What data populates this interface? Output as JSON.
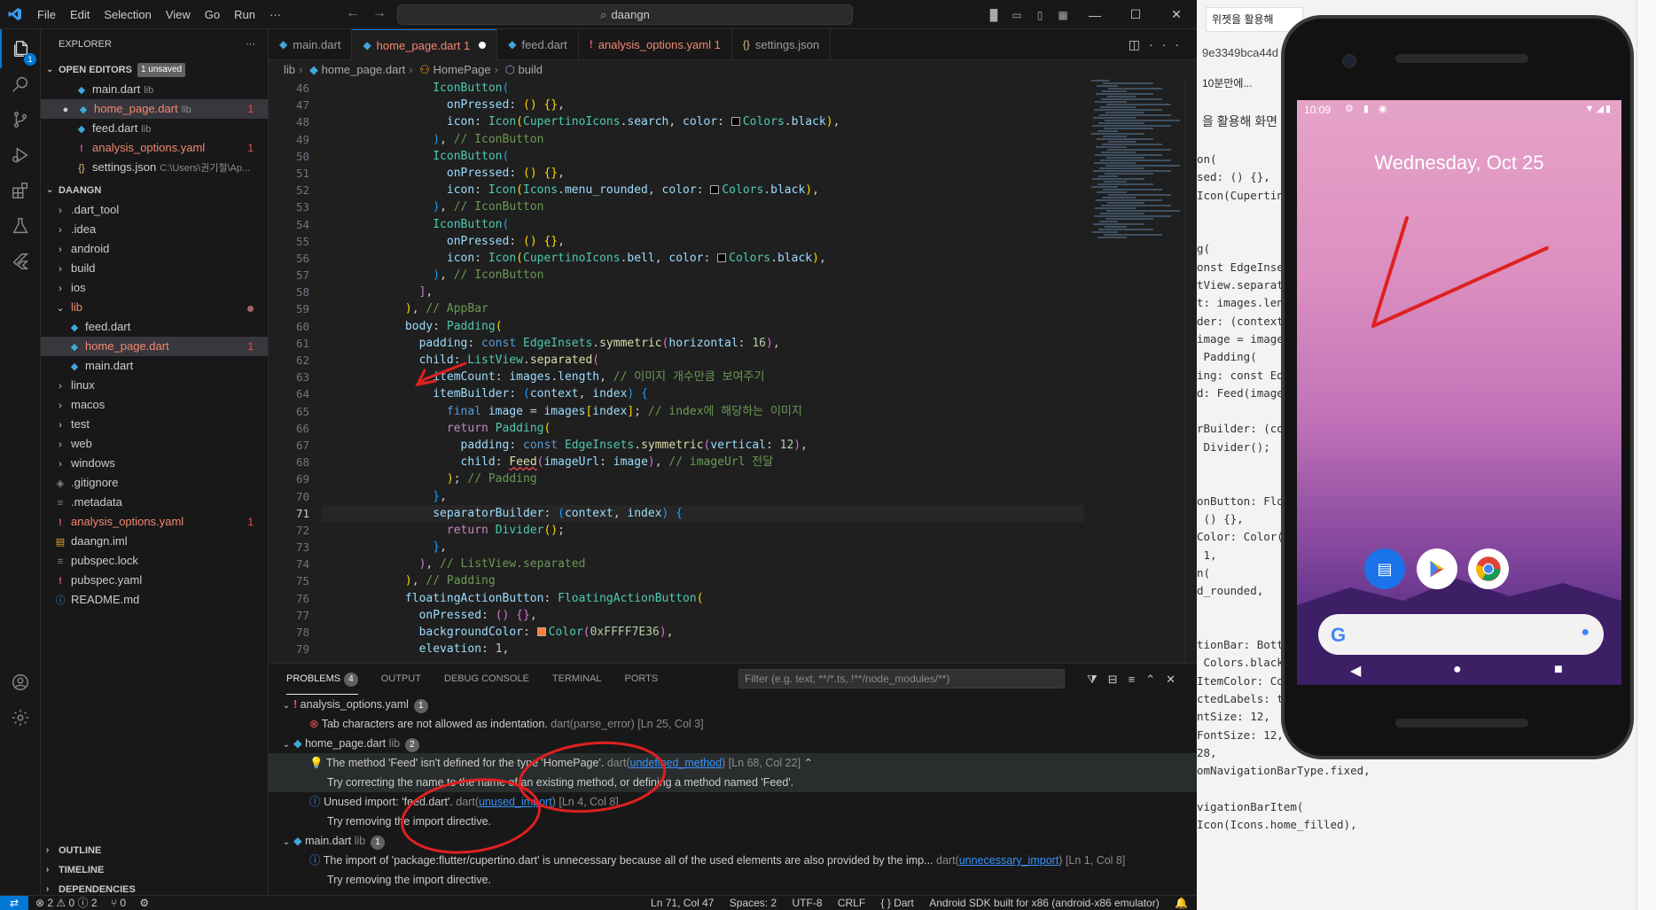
{
  "titlebar": {
    "logo": "VS",
    "menus": [
      "File",
      "Edit",
      "Selection",
      "View",
      "Go",
      "Run",
      "···"
    ],
    "search": "daangn",
    "window_controls": [
      "minimize",
      "maximize",
      "close"
    ]
  },
  "activity": {
    "explorer_badge": "1"
  },
  "sidebar": {
    "title": "EXPLORER",
    "more": "···",
    "open_editors": {
      "title": "OPEN EDITORS",
      "badge": "1 unsaved",
      "items": [
        {
          "name": "main.dart",
          "desc": "lib",
          "count": ""
        },
        {
          "name": "home_page.dart",
          "desc": "lib",
          "count": "1"
        },
        {
          "name": "feed.dart",
          "desc": "lib",
          "count": ""
        },
        {
          "name": "analysis_options.yaml",
          "desc": "",
          "count": "1"
        },
        {
          "name": "settings.json",
          "desc": "C:\\Users\\권기철\\Ap...",
          "count": ""
        }
      ]
    },
    "project": {
      "title": "DAANGN",
      "items": [
        {
          "name": ".dart_tool"
        },
        {
          "name": ".idea"
        },
        {
          "name": "android"
        },
        {
          "name": "build"
        },
        {
          "name": "ios"
        },
        {
          "name": "lib"
        },
        {
          "name": "feed.dart"
        },
        {
          "name": "home_page.dart",
          "count": "1"
        },
        {
          "name": "main.dart"
        },
        {
          "name": "linux"
        },
        {
          "name": "macos"
        },
        {
          "name": "test"
        },
        {
          "name": "web"
        },
        {
          "name": "windows"
        },
        {
          "name": ".gitignore"
        },
        {
          "name": ".metadata"
        },
        {
          "name": "analysis_options.yaml",
          "count": "1"
        },
        {
          "name": "daangn.iml"
        },
        {
          "name": "pubspec.lock"
        },
        {
          "name": "pubspec.yaml"
        },
        {
          "name": "README.md"
        }
      ]
    },
    "bottom_sections": [
      "OUTLINE",
      "TIMELINE",
      "DEPENDENCIES"
    ]
  },
  "tabs": [
    {
      "name": "main.dart",
      "extra": ""
    },
    {
      "name": "home_page.dart",
      "extra": "1"
    },
    {
      "name": "feed.dart",
      "extra": ""
    },
    {
      "name": "analysis_options.yaml",
      "extra": "1"
    },
    {
      "name": "settings.json",
      "extra": ""
    }
  ],
  "breadcrumb": [
    "lib",
    "home_page.dart",
    "HomePage",
    "build"
  ],
  "editor": {
    "line_numbers": [
      "46",
      "47",
      "48",
      "49",
      "50",
      "51",
      "52",
      "53",
      "54",
      "55",
      "56",
      "57",
      "58",
      "59",
      "60",
      "61",
      "62",
      "63",
      "64",
      "65",
      "66",
      "67",
      "68",
      "69",
      "70",
      "71",
      "72",
      "73",
      "74",
      "75",
      "76",
      "77",
      "78",
      "79"
    ],
    "current_line": "71"
  },
  "panel": {
    "tabs": [
      "PROBLEMS",
      "OUTPUT",
      "DEBUG CONSOLE",
      "TERMINAL",
      "PORTS"
    ],
    "problems_count": "4",
    "filter_placeholder": "Filter (e.g. text, **/*.ts, !**/node_modules/**)",
    "groups": [
      {
        "file": "analysis_options.yaml",
        "desc": "",
        "count": "1"
      },
      {
        "file": "home_page.dart",
        "desc": "lib",
        "count": "2"
      },
      {
        "file": "main.dart",
        "desc": "lib",
        "count": "1"
      }
    ],
    "problems": [
      {
        "msg": "Tab characters are not allowed as indentation.",
        "src": "dart(parse_error)",
        "code": "",
        "loc": "[Ln 25, Col 3]"
      },
      {
        "msg": "The method 'Feed' isn't defined for the type 'HomePage'.",
        "src": "dart(",
        "code": "undefined_method",
        "loc": "[Ln 68, Col 22]"
      },
      {
        "msg": "Try correcting the name to the name of an existing method, or defining a method named 'Feed'."
      },
      {
        "msg": "Unused import: 'feed.dart'.",
        "src": "dart(",
        "code": "unused_import",
        "loc": "[Ln 4, Col 8]"
      },
      {
        "msg": "Try removing the import directive."
      },
      {
        "msg": "The import of 'package:flutter/cupertino.dart' is unnecessary because all of the used elements are also provided by the imp...",
        "src": "dart(",
        "code": "unnecessary_import",
        "loc": "[Ln 1, Col 8]"
      },
      {
        "msg": "Try removing the import directive."
      }
    ]
  },
  "statusbar": {
    "problems": "⊗ 2 ⚠ 0 ⓘ 2",
    "ports": "⑂ 0",
    "position": "Ln 71, Col 47",
    "spaces": "Spaces: 2",
    "encoding": "UTF-8",
    "eol": "CRLF",
    "language": "{ } Dart",
    "device": "Android SDK built for x86 (android-x86 emulator)"
  },
  "browser_bg": {
    "tab": "위젯을 활용해",
    "url": "9e3349bca44d",
    "mid": "10분만에...",
    "text": "을 활용해 화면",
    "code_lines": [
      "on(",
      "sed: () {},",
      "Icon(Cupertin",
      "",
      "",
      "g(",
      "onst EdgeInse",
      "tView.separat",
      "t: images.len",
      "der: (context",
      "image = image",
      " Padding(",
      "ing: const Ed",
      "d: Feed(image",
      "",
      "rBuilder: (co",
      " Divider();",
      "",
      "",
      "onButton: Flo",
      " () {},",
      "Color: Color(",
      " 1,",
      "n(",
      "d_rounded,",
      "",
      "",
      "tionBar: Bott",
      " Colors.black",
      "ItemColor: Colo",
      "ctedLabels: true,",
      "ntSize: 12,",
      "FontSize: 12,",
      "28,",
      "omNavigationBarType.fixed,",
      "",
      "vigationBarItem(",
      "Icon(Icons.home_filled),"
    ]
  },
  "phone": {
    "time": "10:09",
    "date": "Wednesday, Oct 25"
  }
}
